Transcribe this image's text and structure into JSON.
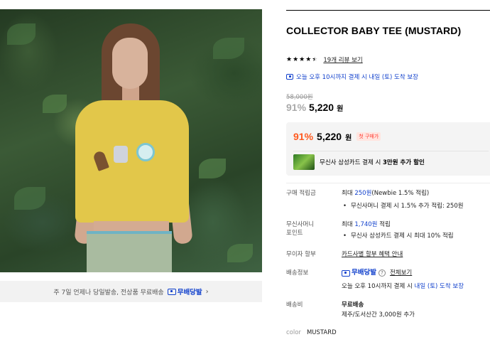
{
  "product": {
    "title": "COLLECTOR BABY TEE (MUSTARD)",
    "rating": 4.5,
    "review_link": "19개 리뷰 보기",
    "delivery_notice": "오늘 오후 10시까지 결제 시 내일 (토) 도착 보장",
    "original_price": "58,000원",
    "discount_rate": "91%",
    "sale_price": "5,220",
    "price_unit": "원"
  },
  "shipping_bar": {
    "text": "주 7일 언제나 당일발송, 전상품 무료배송",
    "badge": "무배당발",
    "chevron": "›"
  },
  "coupon": {
    "discount_rate": "91%",
    "price": "5,220",
    "price_unit": "원",
    "first_purchase_badge": "첫 구매가",
    "card_text_prefix": "무신사 삼성카드 결제 시 ",
    "card_text_bold": "3만원 추가 할인"
  },
  "details": {
    "points_label": "구매 적립금",
    "points_prefix": "최대 ",
    "points_amount": "250원",
    "points_suffix": "(Newbie 1.5% 적립)",
    "points_bullet": "무신사머니 결제 시 1.5% 추가 적립: 250원",
    "point_card_label_1": "무신사머니",
    "point_card_label_2": "포인트",
    "point_card_prefix": "최대 ",
    "point_card_amount": "1,740원",
    "point_card_suffix": " 적립",
    "point_card_bullet": "무신사 삼성카드 결제 시 최대 10% 적립",
    "installment_label": "무이자 할부",
    "installment_value": "카드사별 할부 혜택 안내",
    "shipping_label": "배송정보",
    "shipping_badge": "무배당발",
    "shipping_help": "?",
    "shipping_view_all": "전체보기",
    "shipping_notice_prefix": "오늘 오후 10시까지 결제 시 ",
    "shipping_notice_highlight": "내일 (토) 도착 보장",
    "fee_label": "배송비",
    "fee_value": "무료배송",
    "fee_extra": "제주/도서산간 3,000원 추가"
  },
  "color": {
    "label": "color",
    "value": "MUSTARD"
  },
  "colors": {
    "accent_blue": "#0f3fcc",
    "accent_orange": "#ff5a1f",
    "badge_red": "#ff3b30"
  }
}
